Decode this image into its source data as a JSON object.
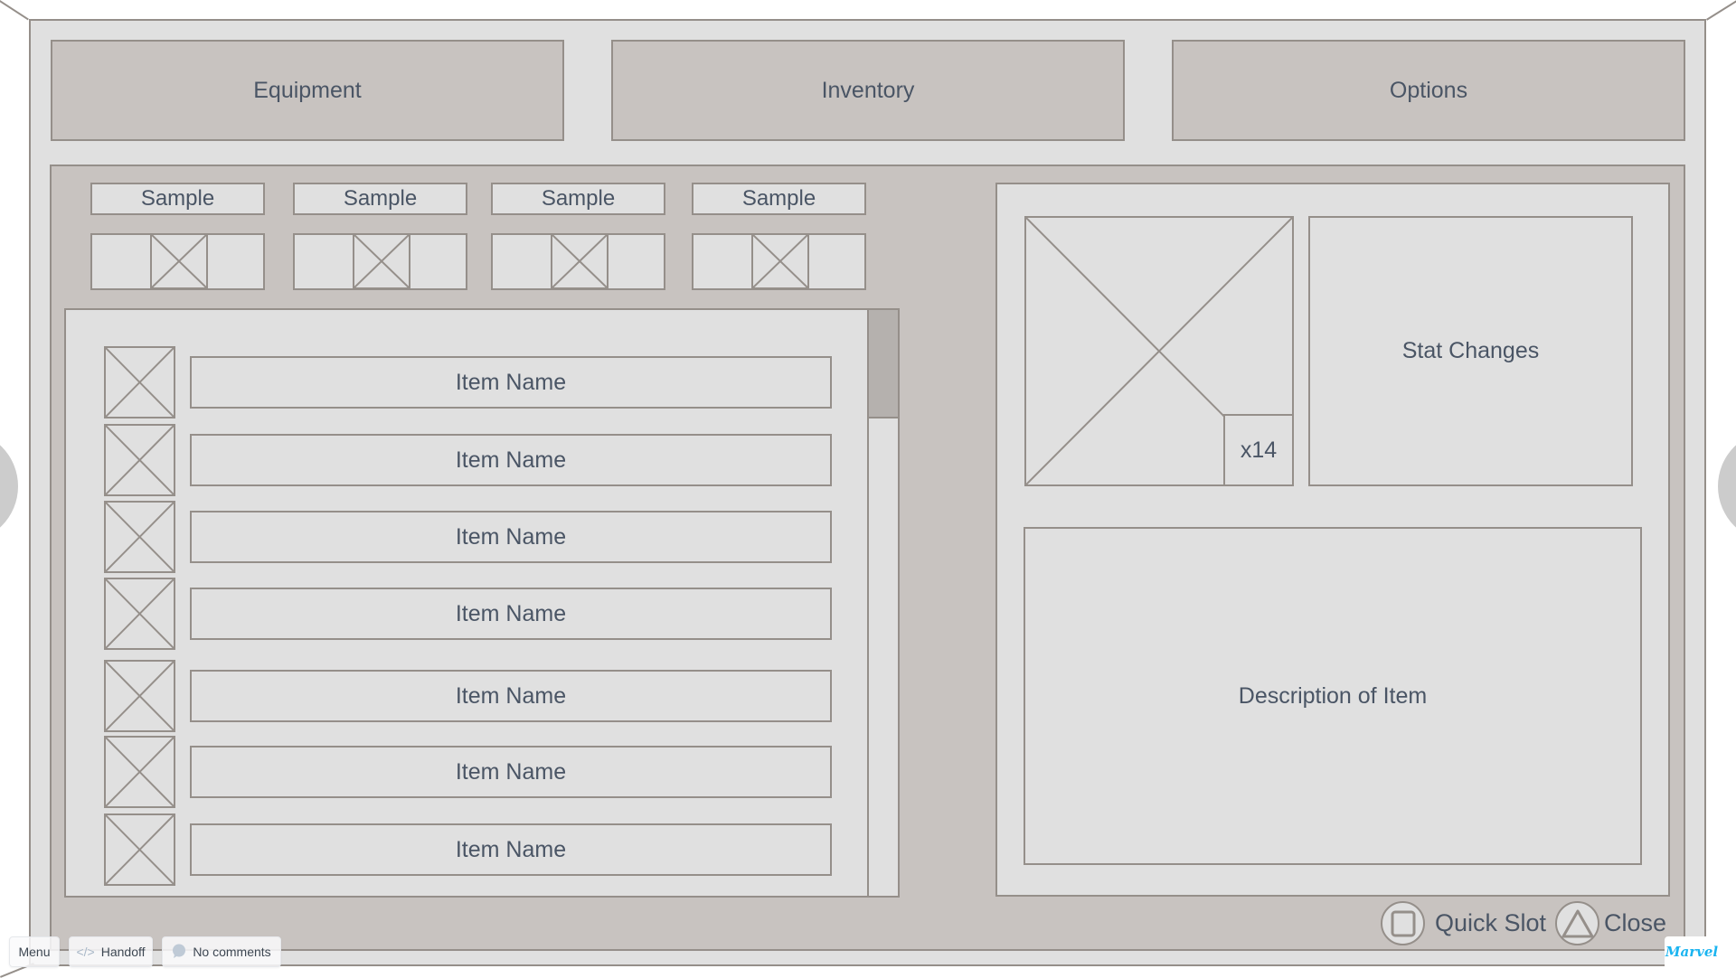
{
  "tabs": [
    {
      "label": "Equipment"
    },
    {
      "label": "Inventory"
    },
    {
      "label": "Options"
    }
  ],
  "categories": [
    {
      "label": "Sample",
      "icon": "image-placeholder-icon"
    },
    {
      "label": "Sample",
      "icon": "image-placeholder-icon"
    },
    {
      "label": "Sample",
      "icon": "image-placeholder-icon"
    },
    {
      "label": "Sample",
      "icon": "image-placeholder-icon"
    }
  ],
  "items": [
    {
      "name": "Item Name"
    },
    {
      "name": "Item Name"
    },
    {
      "name": "Item Name"
    },
    {
      "name": "Item Name"
    },
    {
      "name": "Item Name"
    },
    {
      "name": "Item Name"
    },
    {
      "name": "Item Name"
    }
  ],
  "detail": {
    "quantity": "x14",
    "stat_changes": "Stat Changes",
    "description": "Description of Item"
  },
  "actions": {
    "quick_slot": {
      "label": "Quick Slot",
      "icon": "square-button-icon"
    },
    "close": {
      "label": "Close",
      "icon": "triangle-button-icon"
    }
  },
  "viewer_toolbar": {
    "menu": "Menu",
    "handoff": "Handoff",
    "comments": "No comments"
  },
  "brand": {
    "logo_text": "Marvel",
    "logo_color": "#1ab4f0"
  },
  "scroll": {
    "position_fraction": 0.0
  },
  "colors": {
    "panel_fill": "#c8c3c0",
    "light_fill": "#e0e0e0",
    "border": "#958f8a",
    "text": "#4a5565",
    "scroll_thumb": "#b5b1ae"
  }
}
